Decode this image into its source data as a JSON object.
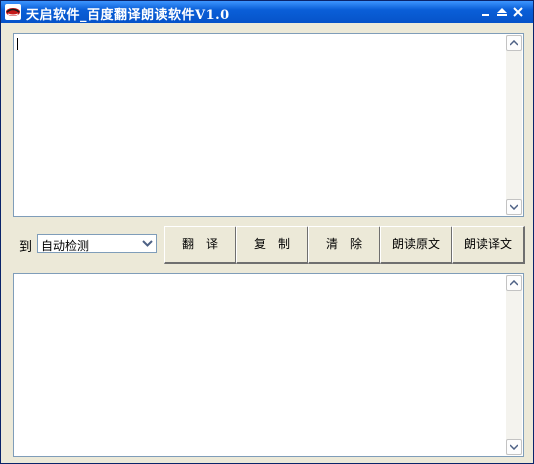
{
  "window": {
    "title": "天启软件_百度翻译朗读软件V1.0"
  },
  "source_text": {
    "value": ""
  },
  "target_language": {
    "label": "到",
    "selected": "自动检测"
  },
  "buttons": {
    "translate": "翻　译",
    "copy": "复　制",
    "clear": "清　除",
    "read_source": "朗读原文",
    "read_translation": "朗读译文"
  },
  "result_text": {
    "value": ""
  },
  "icons": {
    "app": "app-logo-icon",
    "minimize": "minimize-icon",
    "restore": "restore-icon",
    "close": "close-icon"
  }
}
